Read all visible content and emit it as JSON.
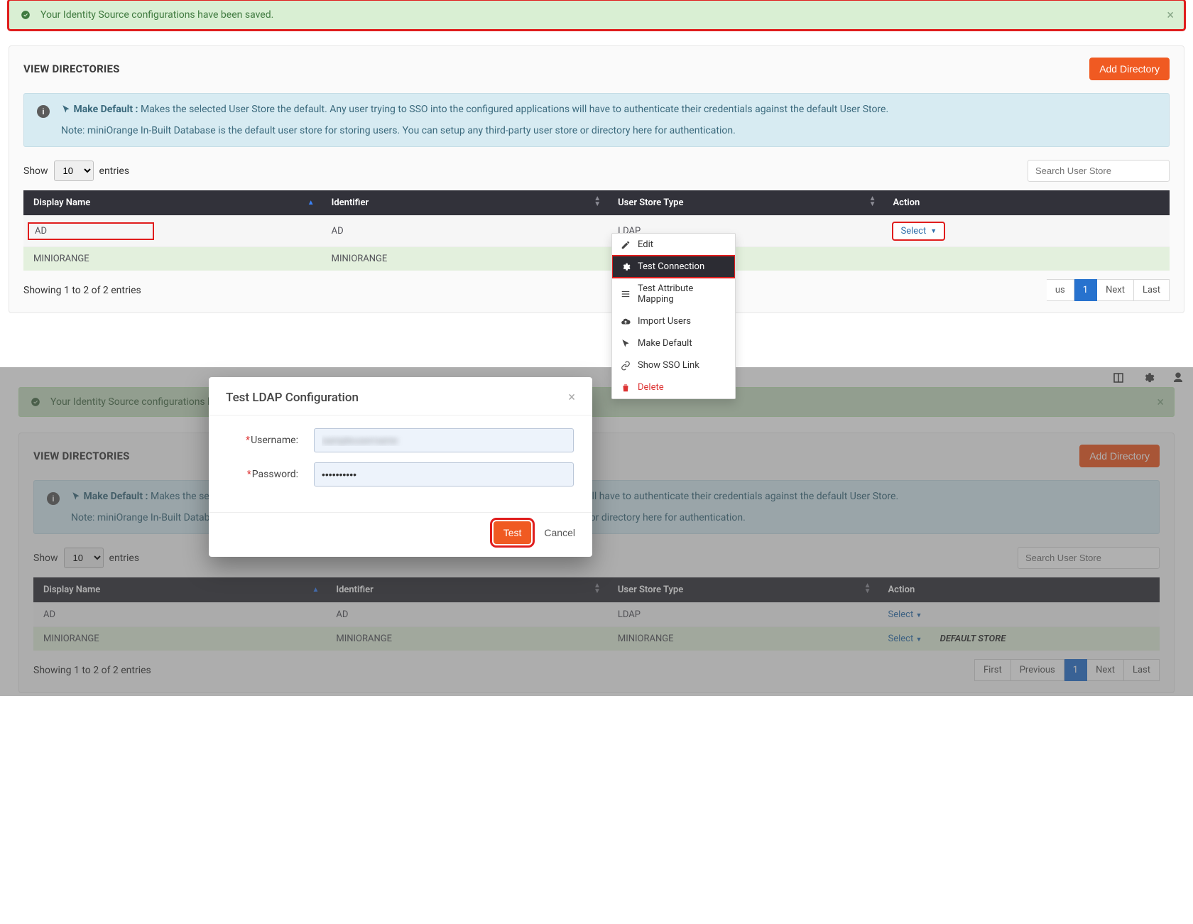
{
  "alert": {
    "text": "Your Identity Source configurations have been saved."
  },
  "directories": {
    "title": "VIEW DIRECTORIES",
    "add_btn": "Add Directory",
    "info_bold": "Make Default :",
    "info_text": " Makes the selected User Store the default. Any user trying to SSO into the configured applications will have to authenticate their credentials against the default User Store.",
    "info_note": "Note: miniOrange In-Built Database is the default user store for storing users. You can setup any third-party user store or directory here for authentication.",
    "show_label_pre": "Show",
    "show_value": "10",
    "show_label_post": "entries",
    "search_placeholder": "Search User Store",
    "columns": {
      "c1": "Display Name",
      "c2": "Identifier",
      "c3": "User Store Type",
      "c4": "Action"
    },
    "rows": [
      {
        "display": "AD",
        "identifier": "AD",
        "type": "LDAP",
        "action": "Select"
      },
      {
        "display": "MINIORANGE",
        "identifier": "MINIORANGE",
        "type": "MINIORANGE",
        "action": "Select",
        "extra": "DEFAULT STORE"
      }
    ],
    "showing": "Showing 1 to 2 of 2 entries",
    "pagination": {
      "first": "First",
      "prev": "Previous",
      "p1": "1",
      "next": "Next",
      "last": "Last"
    }
  },
  "menu": {
    "edit": "Edit",
    "test_conn": "Test Connection",
    "test_attr": "Test Attribute Mapping",
    "import": "Import Users",
    "make_default": "Make Default",
    "show_sso": "Show SSO Link",
    "delete": "Delete"
  },
  "modal": {
    "title": "Test LDAP Configuration",
    "username_label": "Username:",
    "password_label": "Password:",
    "password_value": "••••••••••",
    "test_btn": "Test",
    "cancel_btn": "Cancel"
  }
}
